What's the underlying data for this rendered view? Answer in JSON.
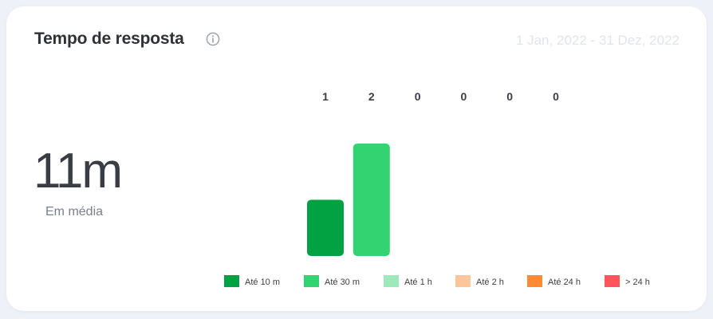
{
  "card": {
    "title": "Tempo de resposta",
    "date_range": "1 Jan, 2022 - 31 Dez, 2022",
    "average_value": "11m",
    "average_label": "Em média"
  },
  "colors": {
    "ate_10m": "#02a242",
    "ate_30m": "#33d372",
    "ate_1h": "#9de8bc",
    "ate_2h": "#fdc59a",
    "ate_24h": "#fd8a34",
    "mais_24h": "#fe555d",
    "title": "#2f3138",
    "muted": "#e1e4ec"
  },
  "icons": {
    "info": "info-circle-icon"
  },
  "chart_data": {
    "type": "bar",
    "categories": [
      "Até 10 m",
      "Até 30 m",
      "Até 1 h",
      "Até 2 h",
      "Até 24 h",
      "> 24 h"
    ],
    "values": [
      1,
      2,
      0,
      0,
      0,
      0
    ],
    "value_labels": [
      "1",
      "2",
      "0",
      "0",
      "0",
      "0"
    ],
    "colors": [
      "#02a242",
      "#33d372",
      "#9de8bc",
      "#fdc59a",
      "#fd8a34",
      "#fe555d"
    ],
    "ylim": [
      0,
      2
    ],
    "grid": false,
    "legend_position": "bottom"
  }
}
